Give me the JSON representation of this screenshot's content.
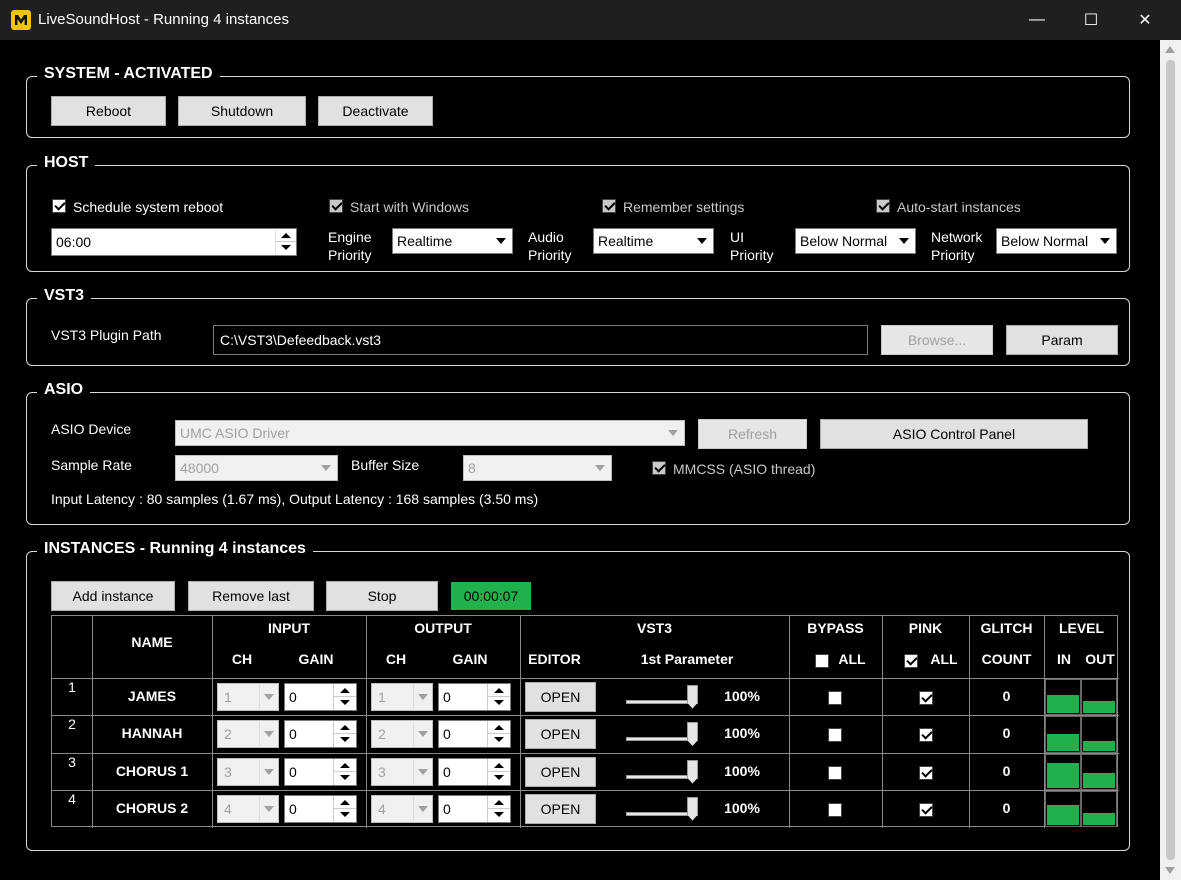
{
  "window": {
    "title": "LiveSoundHost - Running 4 instances",
    "minimize": "—",
    "maximize": "☐",
    "close": "✕"
  },
  "system": {
    "title": "SYSTEM - ACTIVATED",
    "reboot": "Reboot",
    "shutdown": "Shutdown",
    "deactivate": "Deactivate"
  },
  "host": {
    "title": "HOST",
    "schedule_reboot": "Schedule system reboot",
    "schedule_time": "06:00",
    "start_with_windows": "Start with Windows",
    "remember_settings": "Remember settings",
    "auto_start": "Auto-start instances",
    "engine_priority_l1": "Engine",
    "engine_priority_l2": "Priority",
    "engine_priority": "Realtime",
    "audio_priority_l1": "Audio",
    "audio_priority_l2": "Priority",
    "audio_priority": "Realtime",
    "ui_priority_l1": "UI",
    "ui_priority_l2": "Priority",
    "ui_priority": "Below Normal",
    "network_priority_l1": "Network",
    "network_priority_l2": "Priority",
    "network_priority": "Below Normal"
  },
  "vst3": {
    "title": "VST3",
    "path_label": "VST3 Plugin Path",
    "path": "C:\\VST3\\Defeedback.vst3",
    "browse": "Browse...",
    "param": "Param"
  },
  "asio": {
    "title": "ASIO",
    "device_label": "ASIO Device",
    "device": "UMC ASIO Driver",
    "refresh": "Refresh",
    "control_panel": "ASIO Control Panel",
    "sample_rate_label": "Sample Rate",
    "sample_rate": "48000",
    "buffer_size_label": "Buffer Size",
    "buffer_size": "8",
    "mmcss": "MMCSS (ASIO thread)",
    "latency": "Input Latency : 80 samples (1.67 ms), Output Latency : 168 samples (3.50 ms)"
  },
  "instances": {
    "title": "INSTANCES - Running 4 instances",
    "add": "Add instance",
    "remove": "Remove last",
    "stop": "Stop",
    "timer": "00:00:07",
    "headers": {
      "name": "NAME",
      "input": "INPUT",
      "output": "OUTPUT",
      "vst3": "VST3",
      "bypass": "BYPASS",
      "pink": "PINK",
      "glitch": "GLITCH",
      "level": "LEVEL",
      "ch": "CH",
      "gain": "GAIN",
      "editor": "EDITOR",
      "first_param": "1st Parameter",
      "all": "ALL",
      "count": "COUNT",
      "in": "IN",
      "out": "OUT"
    },
    "bypass_all": false,
    "pink_all": true,
    "rows": [
      {
        "num": "1",
        "name": "JAMES",
        "in_ch": "1",
        "in_gain": "0",
        "out_ch": "1",
        "out_gain": "0",
        "open": "OPEN",
        "param": "100%",
        "bypass": false,
        "pink": true,
        "glitch": "0",
        "level_in": 0.55,
        "level_out": 0.35
      },
      {
        "num": "2",
        "name": "HANNAH",
        "in_ch": "2",
        "in_gain": "0",
        "out_ch": "2",
        "out_gain": "0",
        "open": "OPEN",
        "param": "100%",
        "bypass": false,
        "pink": true,
        "glitch": "0",
        "level_in": 0.5,
        "level_out": 0.3
      },
      {
        "num": "3",
        "name": "CHORUS 1",
        "in_ch": "3",
        "in_gain": "0",
        "out_ch": "3",
        "out_gain": "0",
        "open": "OPEN",
        "param": "100%",
        "bypass": false,
        "pink": true,
        "glitch": "0",
        "level_in": 0.75,
        "level_out": 0.45
      },
      {
        "num": "4",
        "name": "CHORUS 2",
        "in_ch": "4",
        "in_gain": "0",
        "out_ch": "4",
        "out_gain": "0",
        "open": "OPEN",
        "param": "100%",
        "bypass": false,
        "pink": true,
        "glitch": "0",
        "level_in": 0.6,
        "level_out": 0.35
      }
    ]
  },
  "colors": {
    "accent_green": "#21b14c",
    "background": "#000000"
  }
}
